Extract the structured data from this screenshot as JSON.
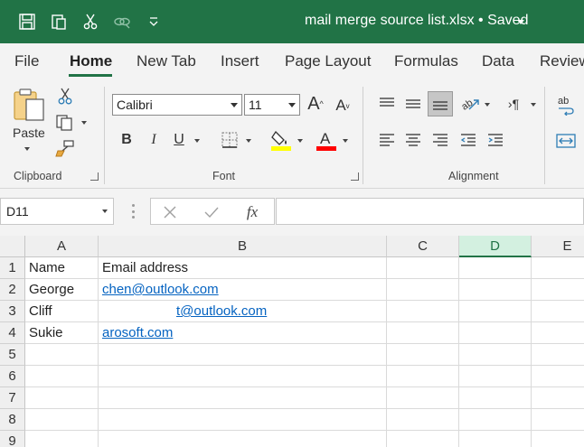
{
  "window": {
    "title": "mail merge source list.xlsx • Saved",
    "quick_access": [
      "save-icon",
      "touch-mode-icon",
      "cut-icon",
      "link-icon",
      "customize-icon"
    ],
    "accent": "#217346"
  },
  "tabs": [
    "File",
    "Home",
    "New Tab",
    "Insert",
    "Page Layout",
    "Formulas",
    "Data",
    "Review"
  ],
  "active_tab": "Home",
  "ribbon": {
    "clipboard": {
      "label": "Clipboard",
      "paste_label": "Paste"
    },
    "font": {
      "label": "Font",
      "font_name": "Calibri",
      "font_size": "11",
      "highlight_color": "#ffff00",
      "font_color": "#ff0000"
    },
    "alignment": {
      "label": "Alignment"
    }
  },
  "formula_bar": {
    "name_box": "D11",
    "formula": ""
  },
  "columns": [
    "A",
    "B",
    "C",
    "D",
    "E"
  ],
  "selected_column": "D",
  "rows": [
    "1",
    "2",
    "3",
    "4",
    "5",
    "6",
    "7",
    "8",
    "9"
  ],
  "cells": {
    "A1": "Name",
    "B1": "Email address",
    "A2": "George",
    "B2": "chen@outlook.com",
    "A3": "Cliff",
    "B3": "t@outlook.com",
    "A4": "Sukie",
    "B4": "arosoft.com"
  }
}
